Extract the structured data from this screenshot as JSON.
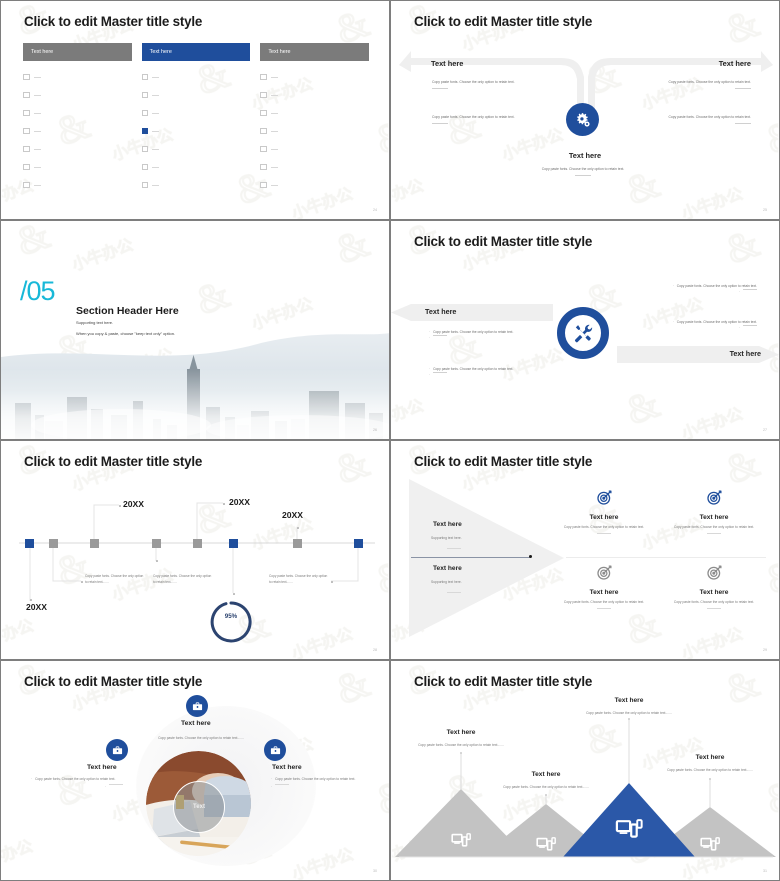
{
  "common": {
    "master_title": "Click to edit Master title style",
    "text_here": "Text here",
    "body_copy": "Copy paste fonts. Choose the only option to retain text.",
    "body_copy_short": "Copy paste fonts. Choose the only option to retain text.......",
    "supporting": "Supporting text here.",
    "accent_blue": "#1F4E9C",
    "accent_gray": "#7B7B7B",
    "accent_cyan": "#18B8D8"
  },
  "slides": [
    {
      "id": "slide-24",
      "page": "24",
      "title": "Click to edit Master title style",
      "columns": [
        {
          "header": "Text here",
          "style": "gray",
          "rows": 7,
          "checked_index": -1
        },
        {
          "header": "Text here",
          "style": "blue",
          "rows": 7,
          "checked_index": 3
        },
        {
          "header": "Text here",
          "style": "gray",
          "rows": 7,
          "checked_index": -1
        }
      ]
    },
    {
      "id": "slide-25",
      "page": "25",
      "title": "Click to edit Master title style",
      "left_label": "Text here",
      "right_label": "Text here",
      "center_label": "Text here",
      "center_body": "Copy paste fonts. Choose the only option to retain text.",
      "icon": "gear-icon",
      "blocks": [
        {
          "side": "left",
          "text": "Copy paste fonts. Choose the only option to retain text."
        },
        {
          "side": "left",
          "text": "Copy paste fonts. Choose the only option to retain text."
        },
        {
          "side": "right",
          "text": "Copy paste fonts. Choose the only option to retain text."
        },
        {
          "side": "right",
          "text": "Copy paste fonts. Choose the only option to retain text."
        }
      ]
    },
    {
      "id": "slide-26",
      "page": "26",
      "section_number": "/05",
      "heading": "Section Header Here",
      "sub1": "Supporting text here.",
      "sub2": "When you copy & paste, choose \"keep text only\" option."
    },
    {
      "id": "slide-27",
      "page": "27",
      "title": "Click to edit Master title style",
      "left_label": "Text here",
      "right_label": "Text here",
      "icon": "tools-icon",
      "bullets": [
        {
          "side": "left",
          "text": "Copy paste fonts. Choose the only option to retain text."
        },
        {
          "side": "left",
          "text": "Copy paste fonts. Choose the only option to retain text."
        },
        {
          "side": "right",
          "text": "Copy paste fonts. Choose the only option to retain text."
        },
        {
          "side": "right",
          "text": "Copy paste fonts. Choose the only option to retain text."
        }
      ]
    },
    {
      "id": "slide-28",
      "page": "28",
      "title": "Click to edit Master title style",
      "progress_label": "95%",
      "progress_value": 95,
      "years": [
        "20XX",
        "20XX",
        "20XX",
        "20XX"
      ],
      "captions": [
        "Copy paste fonts. Choose the only option to retain text.......",
        "Copy paste fonts. Choose the only option to retain text.......",
        "Copy paste fonts. Choose the only option to retain text......."
      ]
    },
    {
      "id": "slide-29",
      "page": "29",
      "title": "Click to edit Master title style",
      "left_items": [
        {
          "label": "Text here",
          "sub": "Supporting text here."
        },
        {
          "label": "Text here",
          "sub": "Supporting text here."
        }
      ],
      "cells": [
        {
          "label": "Text here",
          "body": "Copy paste fonts. Choose the only option to retain text.",
          "icon": "target-icon",
          "color": "#1F4E9C"
        },
        {
          "label": "Text here",
          "body": "Copy paste fonts. Choose the only option to retain text.",
          "icon": "target-icon",
          "color": "#1F4E9C"
        },
        {
          "label": "Text here",
          "body": "Copy paste fonts. Choose the only option to retain text.",
          "icon": "target-icon",
          "color": "#8C8C8C"
        },
        {
          "label": "Text here",
          "body": "Copy paste fonts. Choose the only option to retain text.",
          "icon": "target-icon",
          "color": "#8C8C8C"
        }
      ]
    },
    {
      "id": "slide-30",
      "page": "30",
      "title": "Click to edit Master title style",
      "lens_label": "Text",
      "nodes": [
        {
          "pos": "top",
          "label": "Text here",
          "body": "Copy paste fonts. Choose the only option to retain text.......",
          "icon": "briefcase-icon"
        },
        {
          "pos": "left",
          "label": "Text here",
          "body": "Copy paste fonts. Choose the only option to retain text.",
          "icon": "briefcase-icon"
        },
        {
          "pos": "right",
          "label": "Text here",
          "body": "Copy paste fonts. Choose the only option to retain text.",
          "icon": "briefcase-icon"
        }
      ]
    },
    {
      "id": "slide-31",
      "page": "31",
      "title": "Click to edit Master title style",
      "peaks": [
        {
          "label": "Text here",
          "body": "Copy paste fonts. Choose the only option to retain text.......",
          "color": "#C3C3C3",
          "icon": "devices-icon"
        },
        {
          "label": "Text here",
          "body": "Copy paste fonts. Choose the only option to retain text.......",
          "color": "#C3C3C3",
          "icon": "devices-icon"
        },
        {
          "label": "Text here",
          "body": "Copy paste fonts. Choose the only option to retain text.......",
          "color": "#2B58A8",
          "icon": "devices-icon"
        },
        {
          "label": "Text here",
          "body": "Copy paste fonts. Choose the only option to retain text.......",
          "color": "#C3C3C3",
          "icon": "devices-icon"
        }
      ]
    }
  ]
}
